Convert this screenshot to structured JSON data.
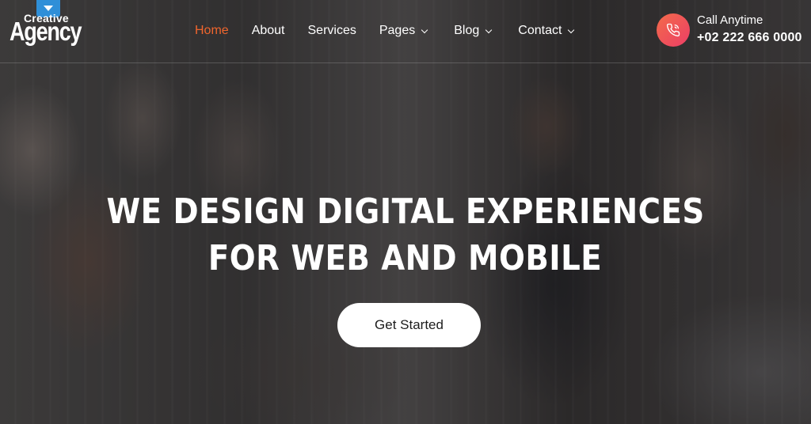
{
  "brand": {
    "logo_top": "Creative",
    "logo_main": "Agency"
  },
  "nav": {
    "items": [
      {
        "label": "Home",
        "active": true,
        "dropdown": false
      },
      {
        "label": "About",
        "active": false,
        "dropdown": false
      },
      {
        "label": "Services",
        "active": false,
        "dropdown": false
      },
      {
        "label": "Pages",
        "active": false,
        "dropdown": true
      },
      {
        "label": "Blog",
        "active": false,
        "dropdown": true
      },
      {
        "label": "Contact",
        "active": false,
        "dropdown": true
      }
    ]
  },
  "contact": {
    "label": "Call Anytime",
    "phone": "+02 222 666 0000",
    "icon": "phone-icon"
  },
  "hero": {
    "title_line1": "WE DESIGN DIGITAL EXPERIENCES",
    "title_line2": "FOR WEB AND MOBILE",
    "cta_label": "Get Started"
  },
  "colors": {
    "accent": "#f0652d",
    "phone_gradient_start": "#f36b4a",
    "phone_gradient_end": "#ec3e66",
    "logo_badge": "#2f8fd8"
  }
}
